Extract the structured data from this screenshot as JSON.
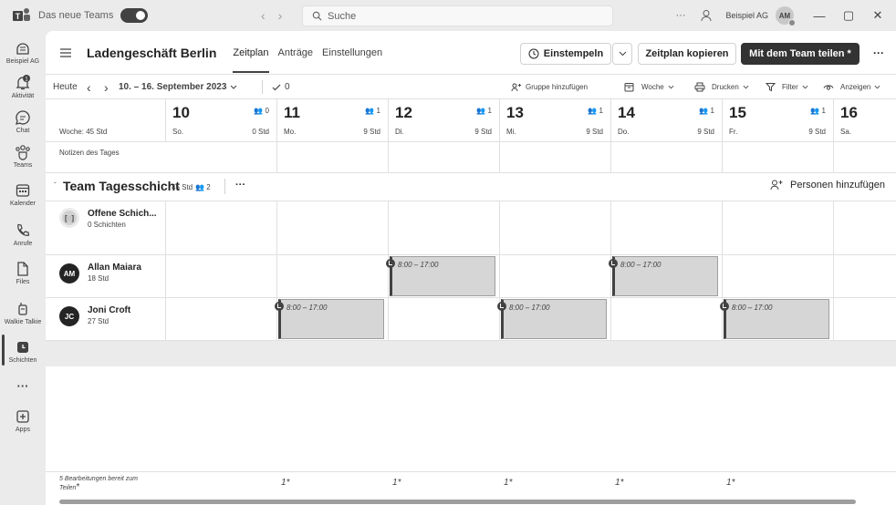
{
  "titlebar": {
    "toggle_label": "Das neue Teams",
    "search_placeholder": "Suche",
    "more": "···",
    "org": "Beispiel AG",
    "avatar": "AM",
    "minimize": "—",
    "restore": "▢",
    "close": "✕"
  },
  "rail": {
    "items": [
      {
        "label": "Beispiel AG",
        "icon": "org-icon"
      },
      {
        "label": "Aktivität",
        "icon": "bell-icon",
        "badge": "1"
      },
      {
        "label": "Chat",
        "icon": "chat-icon"
      },
      {
        "label": "Teams",
        "icon": "teams-icon"
      },
      {
        "label": "Kalender",
        "icon": "calendar-icon"
      },
      {
        "label": "Anrufe",
        "icon": "phone-icon"
      },
      {
        "label": "Files",
        "icon": "file-icon"
      },
      {
        "label": "Walkie Talkie",
        "icon": "walkie-talkie-icon"
      },
      {
        "label": "Schichten",
        "icon": "shifts-icon"
      },
      {
        "label": "···",
        "icon": "more-icon"
      },
      {
        "label": "Apps",
        "icon": "apps-icon"
      }
    ]
  },
  "header": {
    "store": "Ladengeschäft Berlin",
    "tabs": [
      "Zeitplan",
      "Anträge",
      "Einstellungen"
    ],
    "clock_in": "Einstempeln",
    "copy_schedule": "Zeitplan kopieren",
    "share": "Mit dem Team teilen *",
    "more": "···"
  },
  "toolbar": {
    "today": "Heute",
    "range": "10. – 16. September 2023",
    "check_count": "0",
    "add_group": "Gruppe hinzufügen",
    "week": "Woche",
    "print": "Drucken",
    "filter": "Filter",
    "view": "Anzeigen"
  },
  "week": {
    "label": "Woche: 45 Std",
    "notes": "Notizen des Tages",
    "days": [
      {
        "num": "10",
        "wd": "So.",
        "people": "0",
        "hours": "0 Std"
      },
      {
        "num": "11",
        "wd": "Mo.",
        "people": "1",
        "hours": "9 Std"
      },
      {
        "num": "12",
        "wd": "Di.",
        "people": "1",
        "hours": "9 Std"
      },
      {
        "num": "13",
        "wd": "Mi.",
        "people": "1",
        "hours": "9 Std"
      },
      {
        "num": "14",
        "wd": "Do.",
        "people": "1",
        "hours": "9 Std"
      },
      {
        "num": "15",
        "wd": "Fr.",
        "people": "1",
        "hours": "9 Std"
      },
      {
        "num": "16",
        "wd": "Sa.",
        "people": "",
        "hours": ""
      }
    ]
  },
  "group": {
    "name": "Team Tagesschicht",
    "hours": "45 Std",
    "members": "2",
    "more": "···",
    "add_people": "Personen hinzufügen"
  },
  "people": [
    {
      "initials": "[◌]",
      "name": "Offene Schich...",
      "sub": "0 Schichten"
    },
    {
      "initials": "AM",
      "name": "Allan Maiara",
      "sub": "18 Std"
    },
    {
      "initials": "JC",
      "name": "Joni Croft",
      "sub": "27 Std"
    }
  ],
  "shift_time": "8:00 – 17:00",
  "footer": {
    "edits": "5 Bearbeitungen bereit zum Teilen",
    "star": "*",
    "marks": [
      "1",
      "1",
      "1",
      "1",
      "1"
    ]
  }
}
